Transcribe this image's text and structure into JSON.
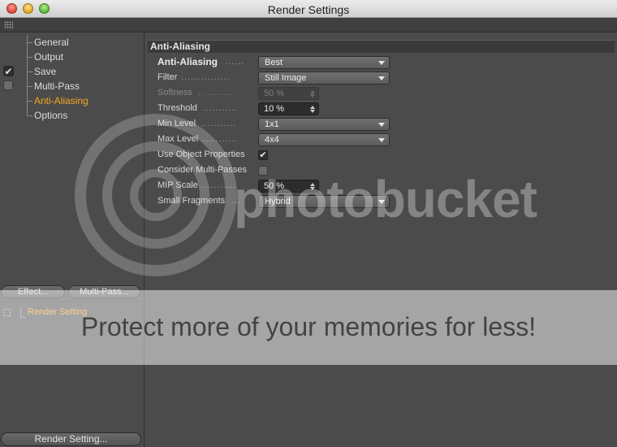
{
  "window": {
    "title": "Render Settings"
  },
  "tree": {
    "items": [
      {
        "label": "General",
        "marker": "none",
        "active": false
      },
      {
        "label": "Output",
        "marker": "none",
        "active": false
      },
      {
        "label": "Save",
        "marker": "check",
        "active": false
      },
      {
        "label": "Multi-Pass",
        "marker": "box",
        "active": false
      },
      {
        "label": "Anti-Aliasing",
        "marker": "none",
        "active": true
      },
      {
        "label": "Options",
        "marker": "none",
        "active": false
      }
    ]
  },
  "buttons": {
    "effect": "Effect...",
    "multipass": "Multi-Pass...",
    "render_setting": "Render Setting..."
  },
  "settings_list": {
    "item": "Render Setting"
  },
  "section": {
    "title": "Anti-Aliasing",
    "rows": [
      {
        "label": "Anti-Aliasing",
        "dots": "......",
        "control": "combo",
        "value": "Best",
        "bold": true,
        "disabled": false
      },
      {
        "label": "Filter",
        "dots": "...............",
        "control": "combo",
        "value": "Still Image",
        "bold": false,
        "disabled": false
      },
      {
        "label": "Softness",
        "dots": "...........",
        "control": "spin",
        "value": "50 %",
        "bold": false,
        "disabled": true
      },
      {
        "label": "Threshold",
        "dots": "...........",
        "control": "spin",
        "value": "10 %",
        "bold": false,
        "disabled": false
      },
      {
        "label": "Min Level",
        "dots": "...........",
        "control": "combo",
        "value": "1x1",
        "bold": false,
        "disabled": false
      },
      {
        "label": "Max Level",
        "dots": "...........",
        "control": "combo",
        "value": "4x4",
        "bold": false,
        "disabled": false
      },
      {
        "label": "Use Object Properties",
        "dots": "",
        "control": "check",
        "value": "✔",
        "bold": false,
        "disabled": false
      },
      {
        "label": "Consider Multi-Passes",
        "dots": "",
        "control": "check",
        "value": "",
        "bold": false,
        "disabled": false
      },
      {
        "label": "MIP Scale",
        "dots": "...........",
        "control": "spin",
        "value": "50 %",
        "bold": false,
        "disabled": false
      },
      {
        "label": "Small Fragments",
        "dots": "...",
        "control": "combo",
        "value": "Hybrid",
        "bold": false,
        "disabled": false
      }
    ]
  },
  "watermark": {
    "brand": "photobucket",
    "tagline": "Protect more of your memories for less!"
  },
  "colors": {
    "accent": "#f5a623",
    "panel": "#4b4b4b"
  },
  "icons": {
    "grip": "grip-icon",
    "check": "checkmark-icon"
  }
}
